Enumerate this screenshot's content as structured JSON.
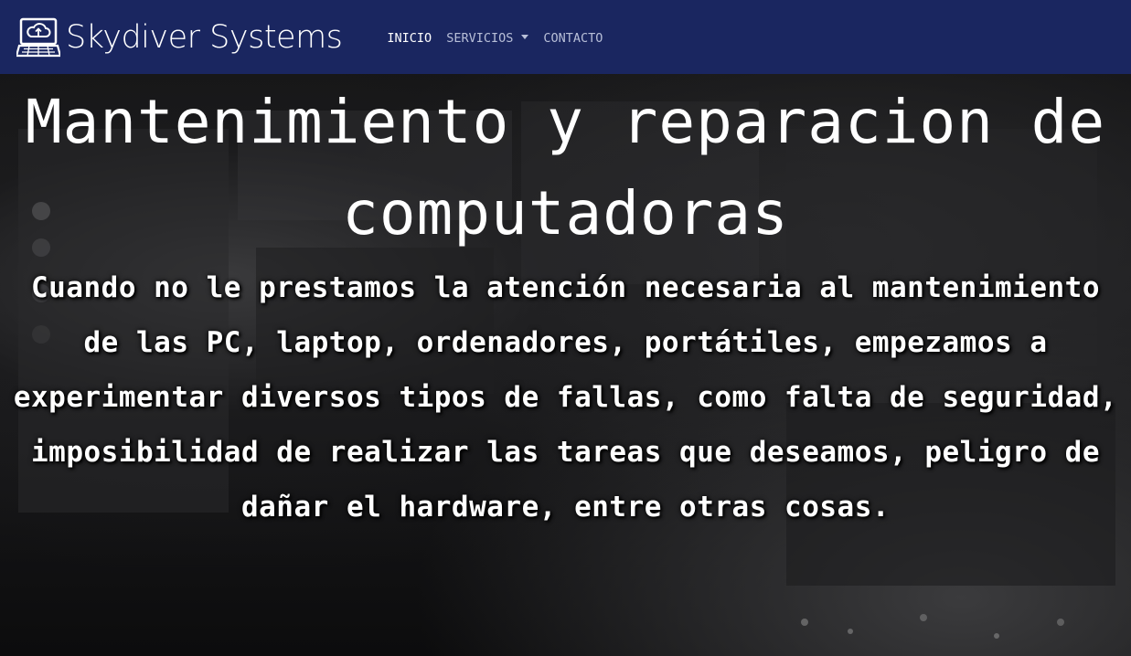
{
  "navbar": {
    "brand_name": "Skydiver Systems",
    "brand_logo_icon": "cloud-laptop-icon",
    "links": [
      {
        "label": "INICIO",
        "active": true
      },
      {
        "label": "SERVICIOS",
        "dropdown": true
      },
      {
        "label": "CONTACTO"
      }
    ]
  },
  "hero": {
    "title": "Mantenimiento y reparacion de computadoras",
    "text": "Cuando no le prestamos la atención necesaria al mantenimiento de las PC, laptop, ordenadores, portátiles, empezamos a experimentar diversos tipos de fallas, como falta de seguridad, imposibilidad de realizar las tareas que deseamos, peligro de dañar el hardware, entre otras cosas."
  },
  "colors": {
    "navbar_bg": "#1a2660",
    "nav_link": "#b8bfd8",
    "nav_link_active": "#ffffff",
    "hero_text": "#ffffff"
  }
}
